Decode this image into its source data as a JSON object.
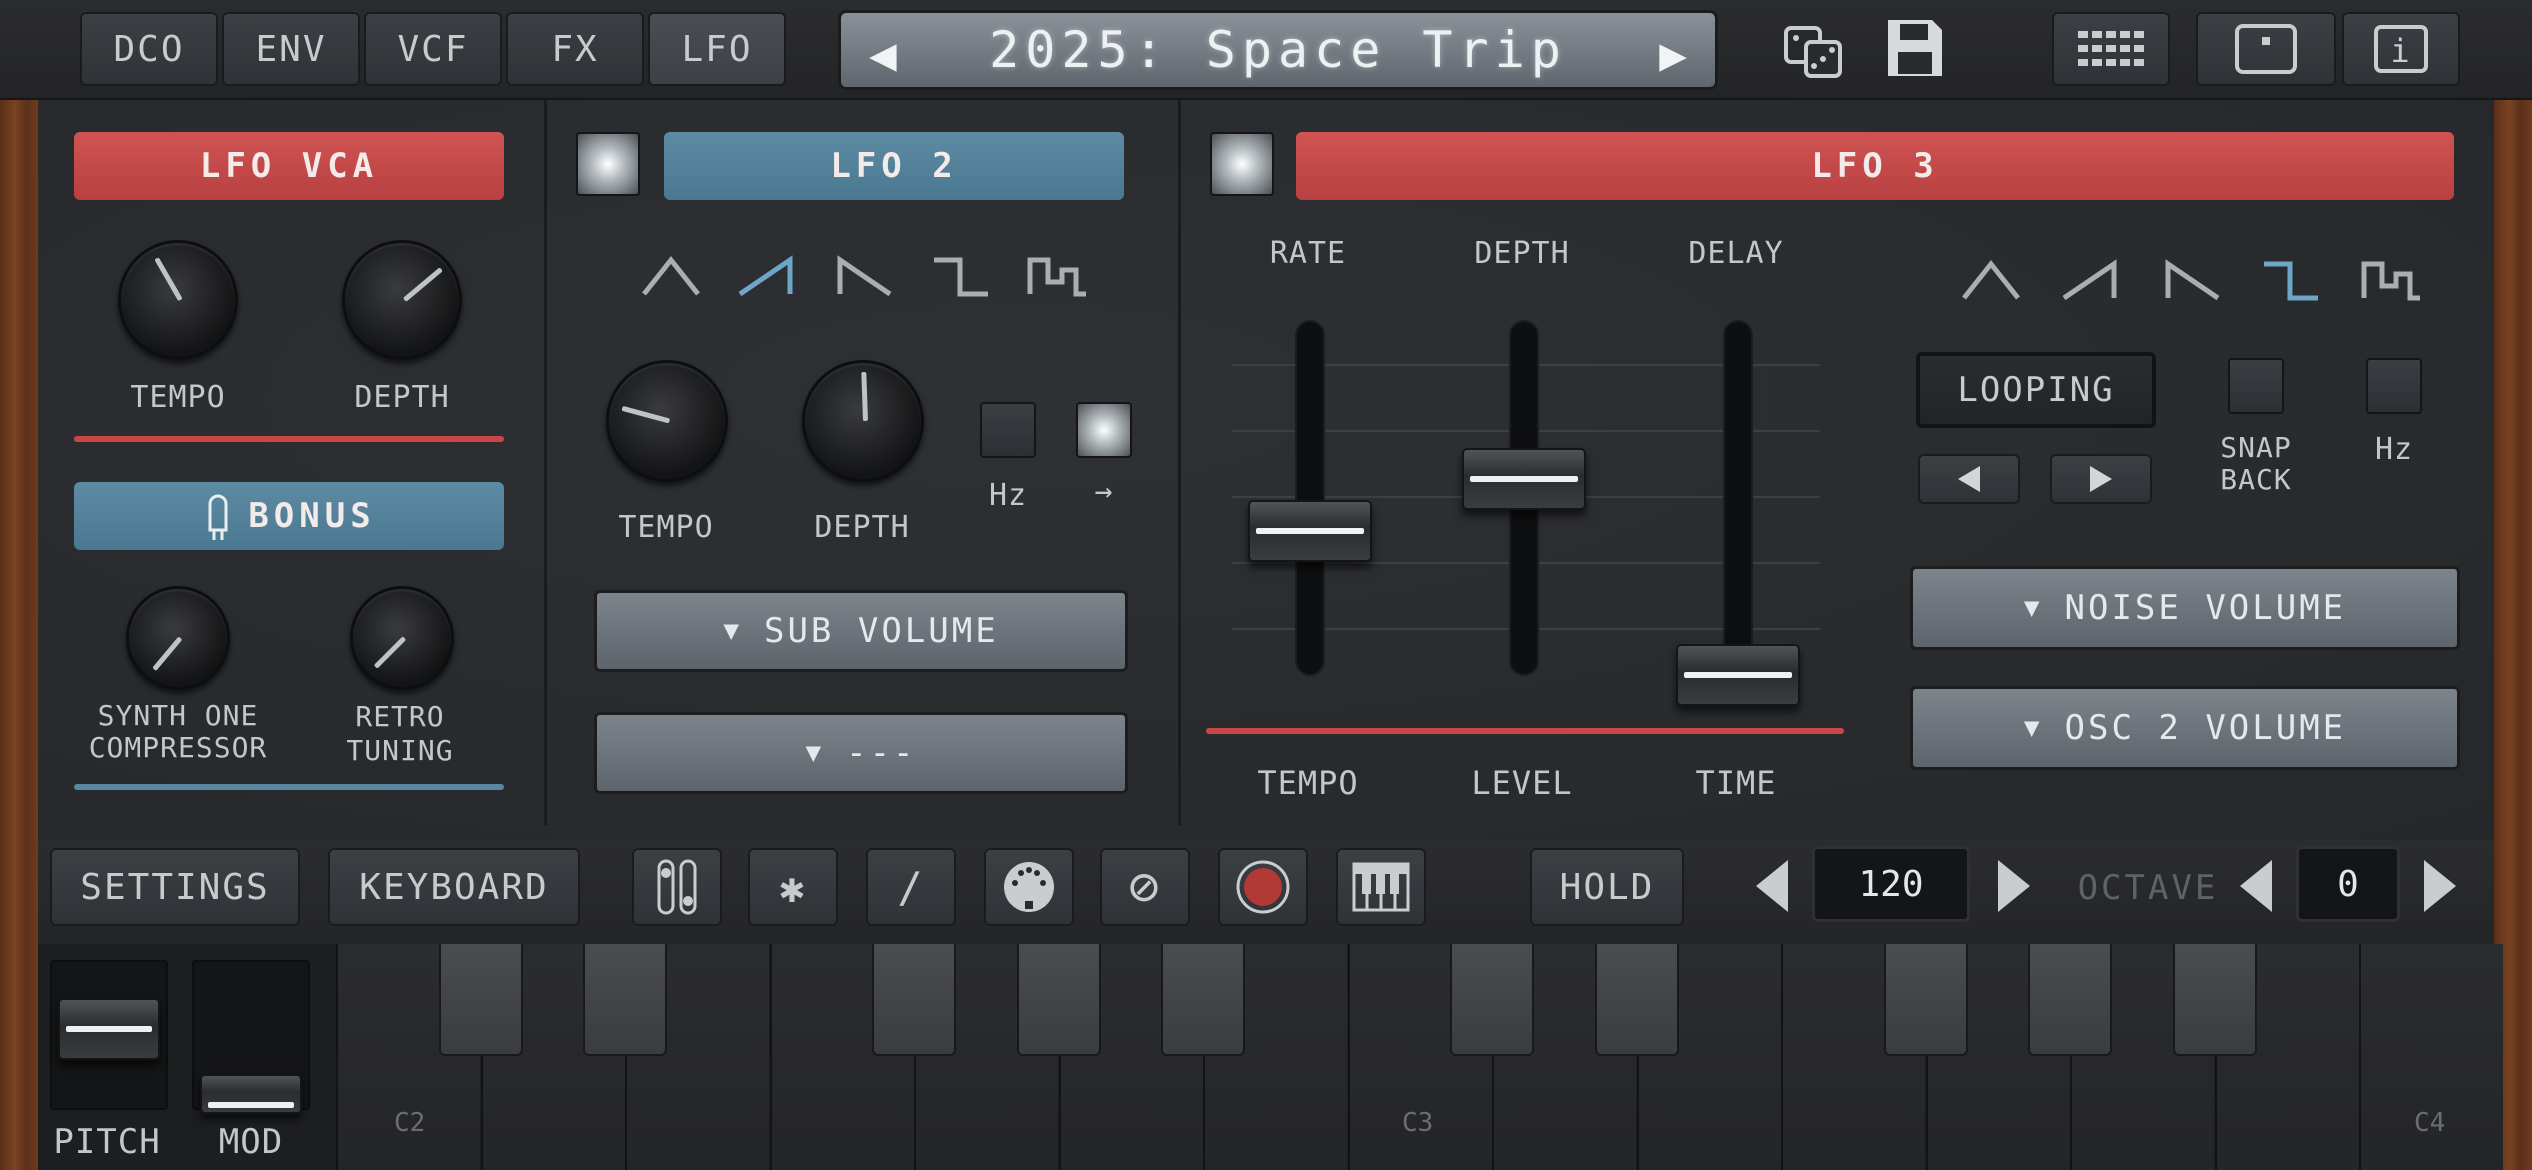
{
  "tabs": [
    {
      "label": "DCO"
    },
    {
      "label": "ENV"
    },
    {
      "label": "VCF"
    },
    {
      "label": "FX"
    },
    {
      "label": "LFO",
      "active": true
    }
  ],
  "preset": {
    "name": "2025: Space Trip",
    "prev": "◀",
    "next": "▶"
  },
  "top_icons": [
    "dice-icon",
    "save-icon",
    "grid-icon",
    "view-icon",
    "info-icon"
  ],
  "info_glyph": "i",
  "lfo_vca": {
    "title": "LFO VCA",
    "knobs": [
      {
        "label": "TEMPO"
      },
      {
        "label": "DEPTH"
      }
    ]
  },
  "bonus": {
    "title": "BONUS",
    "knobs": [
      {
        "label": "SYNTH ONE\nCOMPRESSOR"
      },
      {
        "label": "RETRO\nTUNING"
      }
    ]
  },
  "lfo2": {
    "title": "LFO 2",
    "selected_wave": "ramp-up",
    "knobs": [
      {
        "label": "TEMPO"
      },
      {
        "label": "DEPTH"
      }
    ],
    "hz_label": "Hz",
    "arrow_label": "→",
    "dropdown1": "SUB VOLUME",
    "dropdown2": "---",
    "caret": "▼"
  },
  "lfo3": {
    "title": "LFO 3",
    "selected_wave": "square",
    "slider_labels_top": [
      "RATE",
      "DEPTH",
      "DELAY"
    ],
    "slider_labels_bottom": [
      "TEMPO",
      "LEVEL",
      "TIME"
    ],
    "looping": "LOOPING",
    "snap_back": "SNAP\nBACK",
    "hz_label": "Hz",
    "dropdown1": "NOISE VOLUME",
    "dropdown2": "OSC 2 VOLUME",
    "caret": "▼"
  },
  "bottombar": {
    "settings": "SETTINGS",
    "keyboard": "KEYBOARD",
    "icons": [
      "toggle-icon",
      "bluetooth-icon",
      "link-icon",
      "midi-icon",
      "block-icon",
      "record-icon",
      "piano-icon"
    ],
    "bluetooth_glyph": "✱",
    "link_glyph": "∕",
    "block_glyph": "⊘",
    "hold": "HOLD",
    "tempo": "120",
    "octave_label": "OCTAVE",
    "octave": "0"
  },
  "keyboard": {
    "pitch": "PITCH",
    "mod": "MOD",
    "labels": [
      "C2",
      "C3",
      "C4"
    ]
  },
  "colors": {
    "red": "#c94646",
    "blue": "#5a87a0",
    "selected_wave": "#6ea6c6"
  }
}
